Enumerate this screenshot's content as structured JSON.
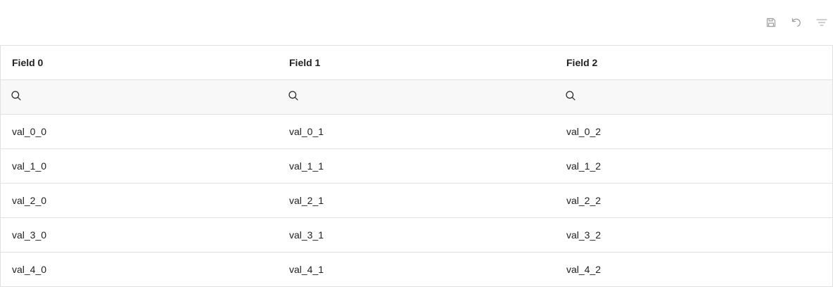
{
  "toolbar": {
    "icons": [
      "save-icon",
      "undo-icon",
      "filter-icon"
    ],
    "icon_color": "#9e9e9e"
  },
  "table": {
    "columns": [
      "Field 0",
      "Field 1",
      "Field 2"
    ],
    "filter_values": [
      "",
      "",
      ""
    ],
    "rows": [
      [
        "val_0_0",
        "val_0_1",
        "val_0_2"
      ],
      [
        "val_1_0",
        "val_1_1",
        "val_1_2"
      ],
      [
        "val_2_0",
        "val_2_1",
        "val_2_2"
      ],
      [
        "val_3_0",
        "val_3_1",
        "val_3_2"
      ],
      [
        "val_4_0",
        "val_4_1",
        "val_4_2"
      ]
    ],
    "border_color": "#e0e0e0",
    "filter_row_bg": "#f8f8f8"
  }
}
